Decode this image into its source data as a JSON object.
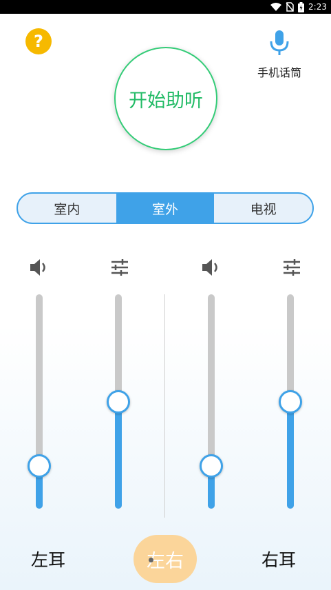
{
  "status_bar": {
    "time": "2:23",
    "icons": [
      "wifi-icon",
      "no-sim-icon",
      "battery-icon"
    ]
  },
  "header": {
    "help_symbol": "?",
    "mic_label": "手机话筒",
    "start_label": "开始助听"
  },
  "modes": {
    "items": [
      "室内",
      "室外",
      "电视"
    ],
    "active": "室外"
  },
  "sliders": {
    "left_volume": 0.2,
    "left_tone": 0.5,
    "right_volume": 0.2,
    "right_tone": 0.5
  },
  "footer": {
    "left_ear": "左耳",
    "both_ears": "左右",
    "right_ear": "右耳"
  },
  "colors": {
    "accent": "#3fa2e8",
    "start_green": "#22bb66",
    "help_yellow": "#f6b900",
    "lr_orange": "#fbd59a"
  }
}
